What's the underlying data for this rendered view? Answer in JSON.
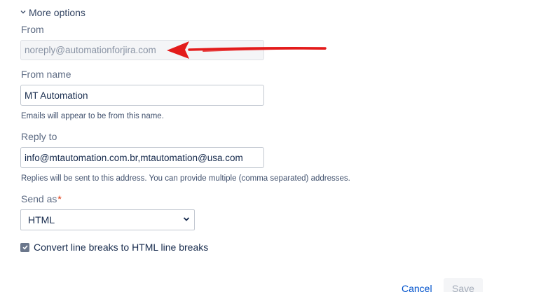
{
  "more_options": {
    "label": "More options",
    "icon": "chevron-down-icon"
  },
  "from": {
    "label": "From",
    "value": "noreply@automationforjira.com",
    "disabled": true
  },
  "from_name": {
    "label": "From name",
    "value": "MT Automation",
    "help": "Emails will appear to be from this name."
  },
  "reply_to": {
    "label": "Reply to",
    "value": "info@mtautomation.com.br,mtautomation@usa.com",
    "help": "Replies will be sent to this address. You can provide multiple (comma separated) addresses."
  },
  "send_as": {
    "label": "Send as",
    "required_marker": "*",
    "selected": "HTML"
  },
  "convert_line_breaks": {
    "label": "Convert line breaks to HTML line breaks",
    "checked": true
  },
  "actions": {
    "cancel_label": "Cancel",
    "save_label": "Save"
  },
  "annotation": {
    "icon": "red-arrow-icon",
    "color": "#e31b1b"
  }
}
